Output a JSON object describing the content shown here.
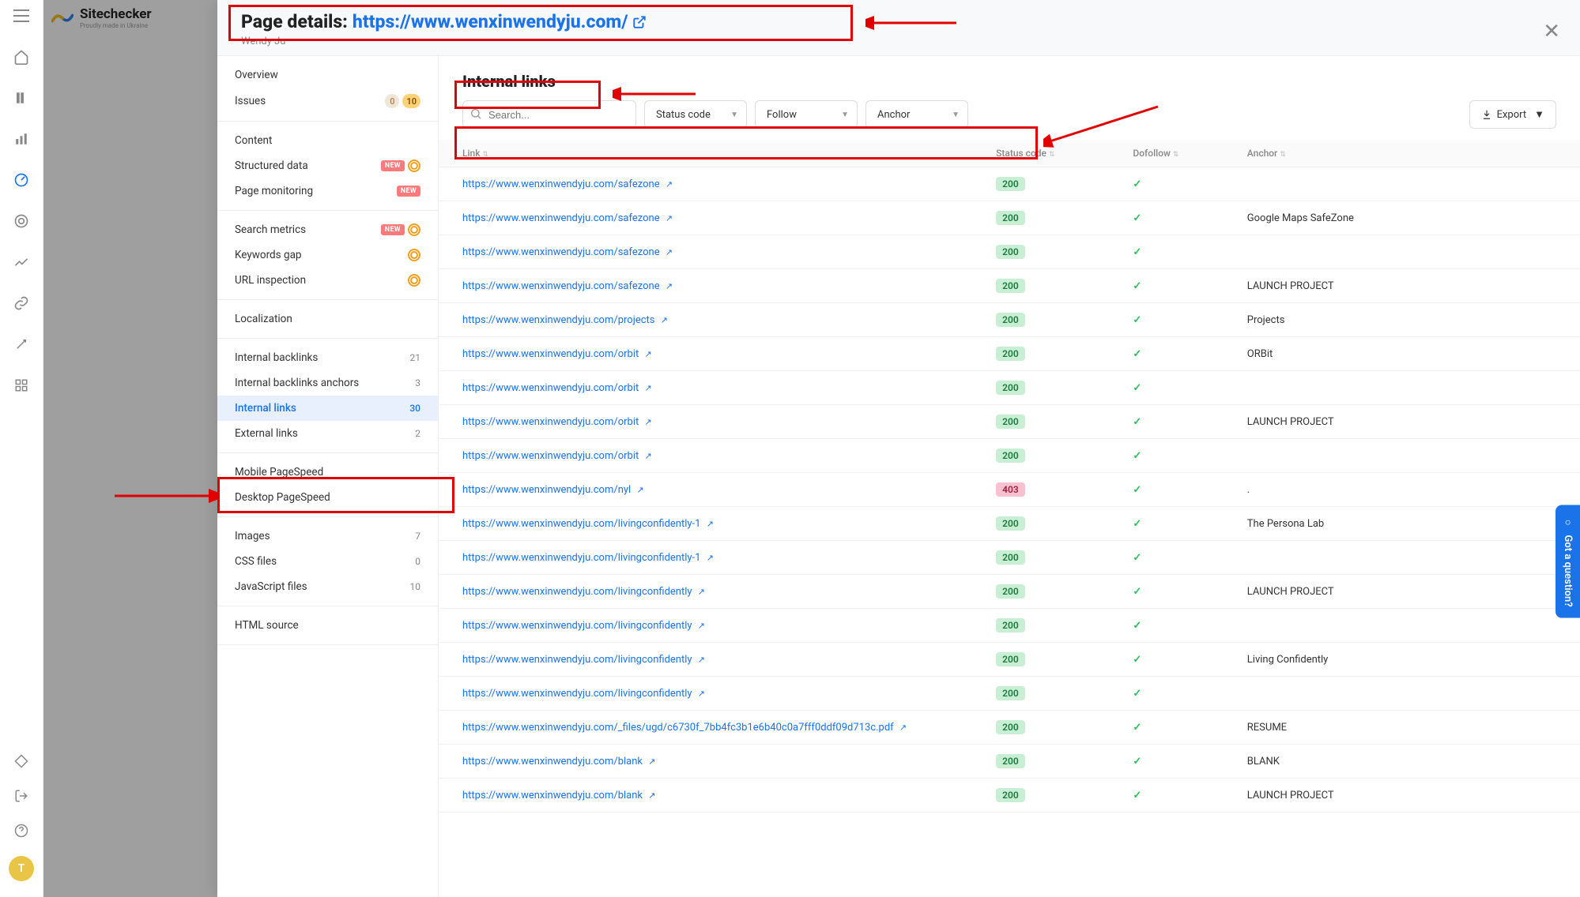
{
  "brand": {
    "name": "Sitechecker",
    "tagline": "Proudly made in Ukraine"
  },
  "header": {
    "title_label": "Page details: ",
    "title_url": "https://www.wenxinwendyju.com/",
    "subtitle": "Wendy Ju"
  },
  "leftnav": {
    "overview": "Overview",
    "issues": "Issues",
    "issues_zero": "0",
    "issues_count": "10",
    "content": "Content",
    "structured": "Structured data",
    "pagemon": "Page monitoring",
    "searchmetrics": "Search metrics",
    "keywordsgap": "Keywords gap",
    "urlinspect": "URL inspection",
    "localization": "Localization",
    "int_backlinks": "Internal backlinks",
    "int_backlinks_count": "21",
    "int_backlinks_anchors": "Internal backlinks anchors",
    "int_backlinks_anchors_count": "3",
    "int_links": "Internal links",
    "int_links_count": "30",
    "ext_links": "External links",
    "ext_links_count": "2",
    "mobile_ps": "Mobile PageSpeed",
    "desktop_ps": "Desktop PageSpeed",
    "images": "Images",
    "images_count": "7",
    "css": "CSS files",
    "css_count": "0",
    "js": "JavaScript files",
    "js_count": "10",
    "html_src": "HTML source",
    "new_badge": "NEW"
  },
  "section": {
    "title": "Internal links"
  },
  "filters": {
    "search_placeholder": "Search...",
    "status": "Status code",
    "follow": "Follow",
    "anchor": "Anchor",
    "export": "Export"
  },
  "columns": {
    "link": "Link",
    "status": "Status code",
    "dofollow": "Dofollow",
    "anchor": "Anchor"
  },
  "rows": [
    {
      "url": "https://www.wenxinwendyju.com/safezone",
      "status": "200",
      "anchor": ""
    },
    {
      "url": "https://www.wenxinwendyju.com/safezone",
      "status": "200",
      "anchor": "Google Maps SafeZone"
    },
    {
      "url": "https://www.wenxinwendyju.com/safezone",
      "status": "200",
      "anchor": ""
    },
    {
      "url": "https://www.wenxinwendyju.com/safezone",
      "status": "200",
      "anchor": "LAUNCH PROJECT"
    },
    {
      "url": "https://www.wenxinwendyju.com/projects",
      "status": "200",
      "anchor": "Projects"
    },
    {
      "url": "https://www.wenxinwendyju.com/orbit",
      "status": "200",
      "anchor": "ORBit"
    },
    {
      "url": "https://www.wenxinwendyju.com/orbit",
      "status": "200",
      "anchor": ""
    },
    {
      "url": "https://www.wenxinwendyju.com/orbit",
      "status": "200",
      "anchor": "LAUNCH PROJECT"
    },
    {
      "url": "https://www.wenxinwendyju.com/orbit",
      "status": "200",
      "anchor": ""
    },
    {
      "url": "https://www.wenxinwendyju.com/nyl",
      "status": "403",
      "anchor": "."
    },
    {
      "url": "https://www.wenxinwendyju.com/livingconfidently-1",
      "status": "200",
      "anchor": "The Persona Lab"
    },
    {
      "url": "https://www.wenxinwendyju.com/livingconfidently-1",
      "status": "200",
      "anchor": ""
    },
    {
      "url": "https://www.wenxinwendyju.com/livingconfidently",
      "status": "200",
      "anchor": "LAUNCH PROJECT"
    },
    {
      "url": "https://www.wenxinwendyju.com/livingconfidently",
      "status": "200",
      "anchor": ""
    },
    {
      "url": "https://www.wenxinwendyju.com/livingconfidently",
      "status": "200",
      "anchor": "Living Confidently"
    },
    {
      "url": "https://www.wenxinwendyju.com/livingconfidently",
      "status": "200",
      "anchor": ""
    },
    {
      "url": "https://www.wenxinwendyju.com/_files/ugd/c6730f_7bb4fc3b1e6b40c0a7fff0ddf09d713c.pdf",
      "status": "200",
      "anchor": "RESUME"
    },
    {
      "url": "https://www.wenxinwendyju.com/blank",
      "status": "200",
      "anchor": "BLANK"
    },
    {
      "url": "https://www.wenxinwendyju.com/blank",
      "status": "200",
      "anchor": "LAUNCH PROJECT"
    }
  ],
  "help": {
    "label": "Got a question?"
  },
  "avatar": {
    "initial": "T"
  }
}
